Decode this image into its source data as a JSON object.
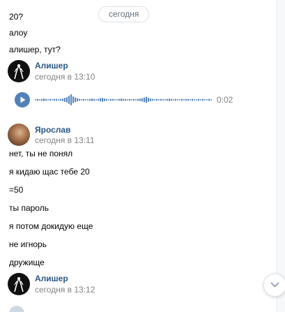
{
  "date_divider": "сегодня",
  "messages_top": [
    "20?",
    "алоу",
    "алишер, тут?"
  ],
  "group1": {
    "author": "Алишер",
    "time": "сегодня в 13:10",
    "voice": {
      "duration": "0:02"
    }
  },
  "group2": {
    "author": "Ярослав",
    "time": "сегодня в 13:11",
    "messages": [
      "нет, ты не понял",
      "я кидаю щас тебе 20",
      "=50",
      "ты пароль",
      "я потом докидую еще",
      "не игнорь",
      "дружище"
    ]
  },
  "group3": {
    "author": "Алишер",
    "time": "сегодня в 13:12"
  },
  "colors": {
    "accent": "#5181b8",
    "author": "#2a5885",
    "muted": "#828282"
  },
  "icons": {
    "play": "play-icon",
    "scroll_down": "chevron-down-icon"
  }
}
